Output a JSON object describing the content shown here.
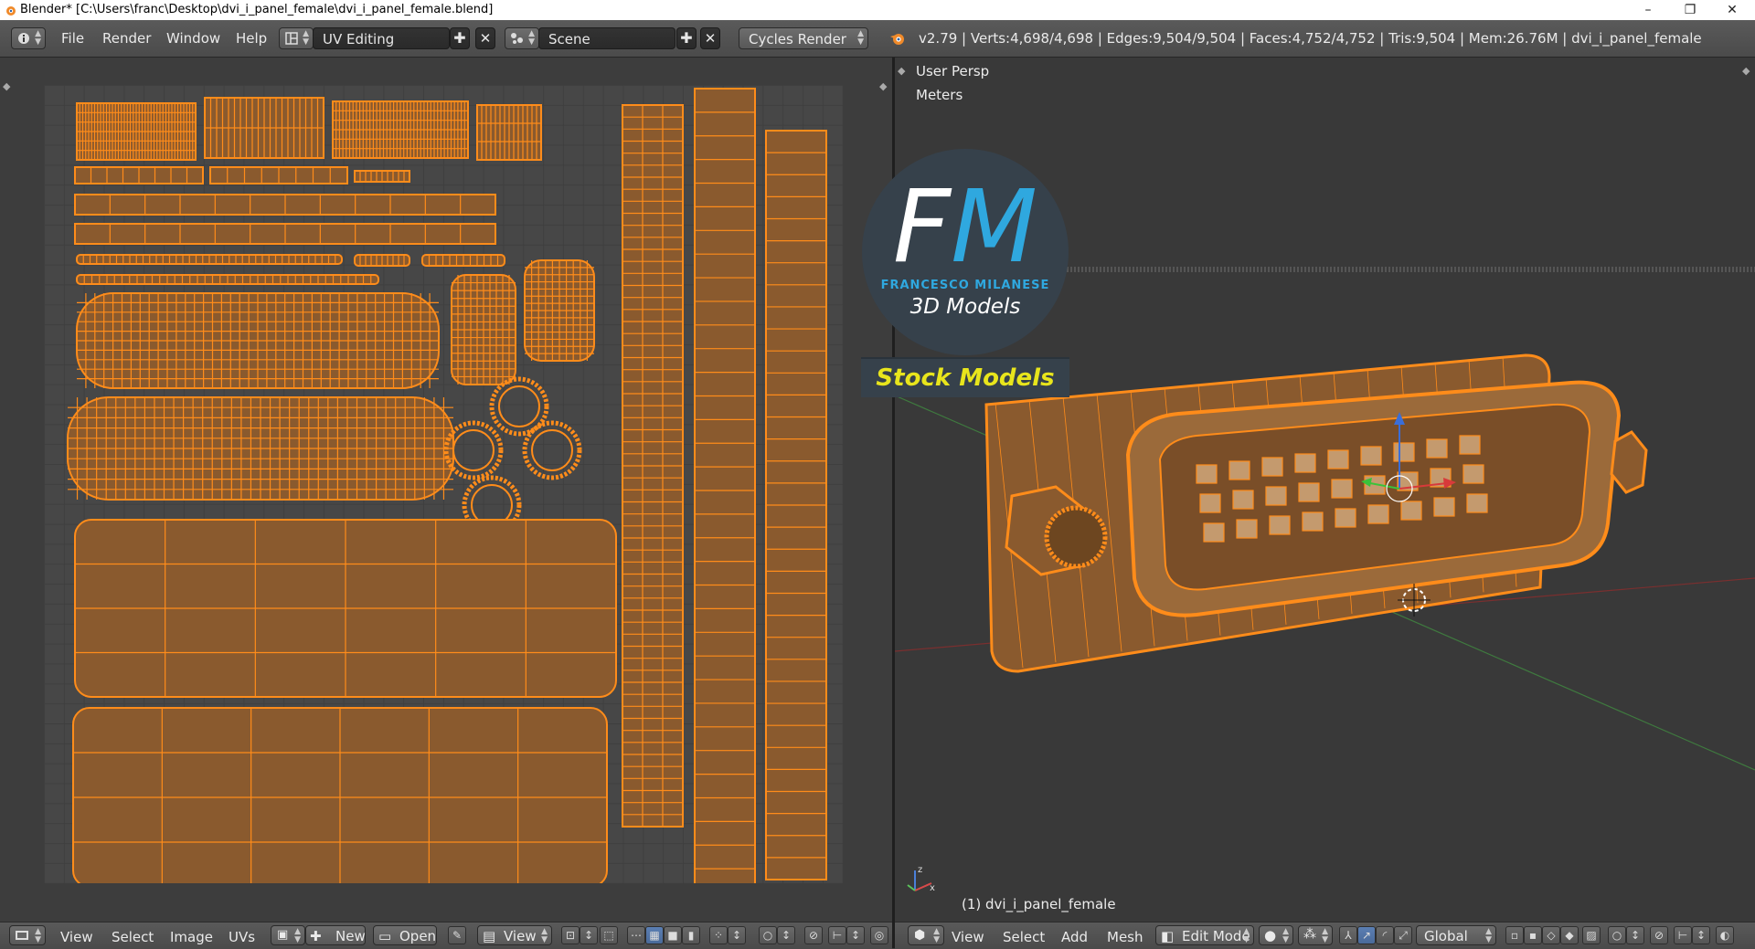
{
  "window": {
    "title": "Blender* [C:\\Users\\franc\\Desktop\\dvi_i_panel_female\\dvi_i_panel_female.blend]",
    "controls": [
      "–",
      "❐",
      "✕"
    ]
  },
  "info_header": {
    "menus": [
      "File",
      "Render",
      "Window",
      "Help"
    ],
    "screen_layout": "UV Editing",
    "scene": "Scene",
    "render_engine": "Cycles Render",
    "stats": "v2.79 | Verts:4,698/4,698 | Edges:9,504/9,504 | Faces:4,752/4,752 | Tris:9,504 | Mem:26.76M | dvi_i_panel_female"
  },
  "uv_editor": {
    "footer_menus": [
      "View",
      "Select",
      "Image",
      "UVs"
    ],
    "new_label": "New",
    "open_label": "Open",
    "view_label": "View"
  },
  "viewport": {
    "view_name": "User Persp",
    "units": "Meters",
    "object_label": "(1) dvi_i_panel_female",
    "footer_menus": [
      "View",
      "Select",
      "Add",
      "Mesh"
    ],
    "mode": "Edit Mode",
    "orientation": "Global"
  },
  "logo": {
    "letter_f": "F",
    "letter_m": "M",
    "brand": "FRANCESCO MILANESE",
    "subtitle": "3D Models",
    "banner": "Stock Models"
  },
  "colors": {
    "mesh_orange": "#ff8c1a",
    "face_fill": "#8a5a2e",
    "accent_blue": "#2fa8df",
    "banner_yellow": "#e8e51c"
  }
}
